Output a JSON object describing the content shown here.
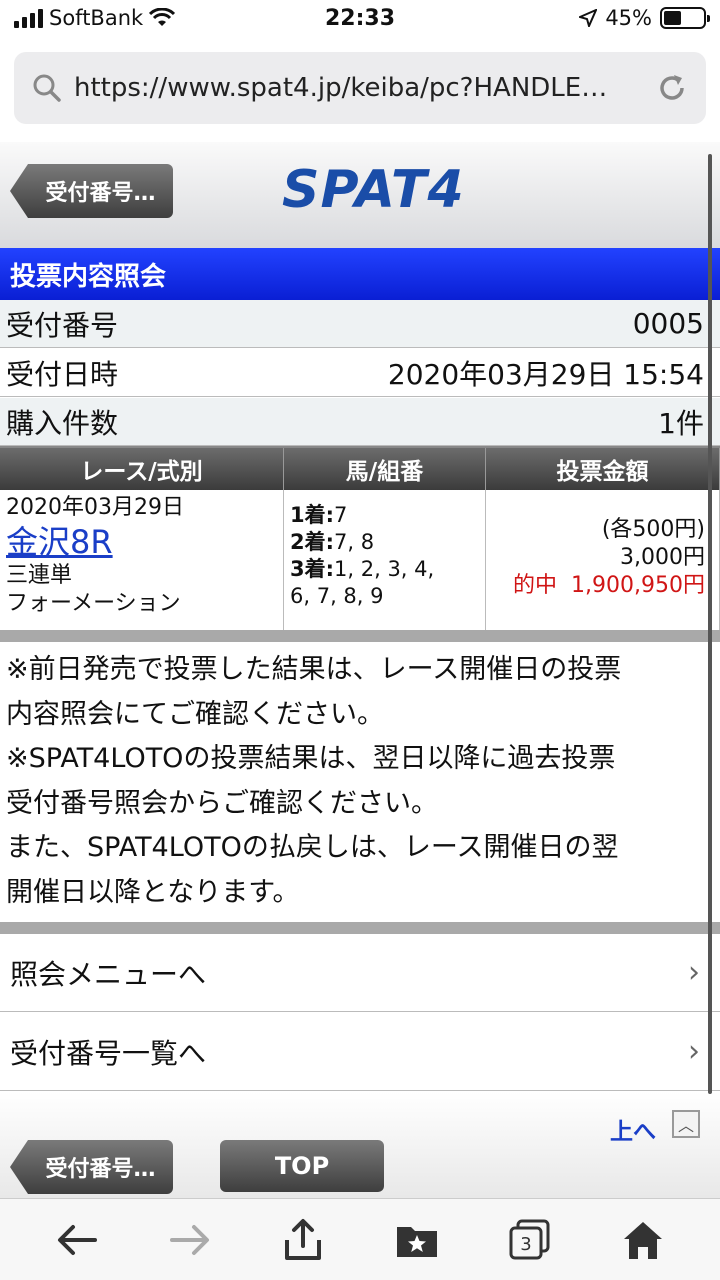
{
  "status_bar": {
    "carrier": "SoftBank",
    "time": "22:33",
    "battery_percent": "45%",
    "battery_level": 0.45
  },
  "browser": {
    "url": "https://www.spat4.jp/keiba/pc?HANDLE…",
    "tab_count": "3"
  },
  "site": {
    "logo": "SPAT4",
    "back_label": "受付番号…",
    "page_title": "投票内容照会"
  },
  "info": [
    {
      "label": "受付番号",
      "value": "0005"
    },
    {
      "label": "受付日時",
      "value": "2020年03月29日 15:54"
    },
    {
      "label": "購入件数",
      "value": "1件"
    }
  ],
  "table": {
    "headers": [
      "レース/式別",
      "馬/組番",
      "投票金額"
    ],
    "row": {
      "date": "2020年03月29日",
      "race": "金沢8R",
      "bet_type": "三連単",
      "method": "フォーメーション",
      "horses": [
        {
          "label": "1着:",
          "value": "7"
        },
        {
          "label": "2着:",
          "value": "7, 8"
        },
        {
          "label": "3着:",
          "value": "1, 2, 3, 4,"
        },
        {
          "label": "",
          "value": "6, 7, 8, 9"
        }
      ],
      "each": "(各500円)",
      "amount": "3,000円",
      "hit_label": "的中",
      "payout": "1,900,950円"
    }
  },
  "notes": [
    "※前日発売で投票した結果は、レース開催日の投票",
    "内容照会にてご確認ください。",
    "※SPAT4LOTOの投票結果は、翌日以降に過去投票",
    "受付番号照会からご確認ください。",
    "また、SPAT4LOTOの払戻しは、レース開催日の翌",
    "開催日以降となります。"
  ],
  "menu": [
    {
      "label": "照会メニューへ"
    },
    {
      "label": "受付番号一覧へ"
    }
  ],
  "footer": {
    "up_label": "上へ",
    "back_label": "受付番号…",
    "top_label": "TOP"
  }
}
